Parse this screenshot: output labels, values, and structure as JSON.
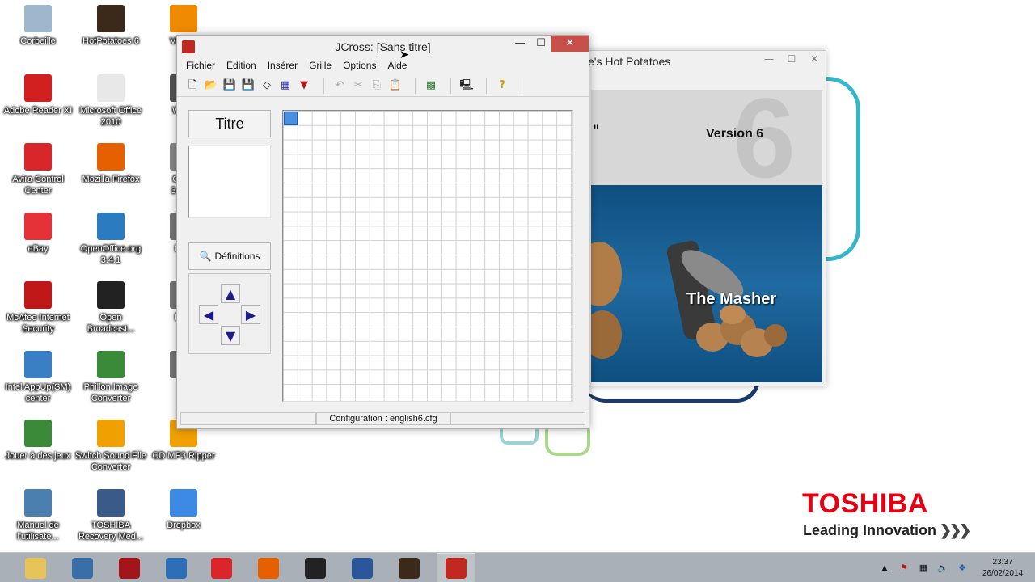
{
  "desktop": {
    "icons": [
      {
        "label": "Corbeille",
        "icon": "recycle-bin-icon",
        "color": "#9fb7cc"
      },
      {
        "label": "HotPotatoes 6",
        "icon": "hotpotatoes-icon",
        "color": "#3b2a1a"
      },
      {
        "label": "VLC m",
        "icon": "vlc-icon",
        "color": "#f08a00"
      },
      {
        "label": "Adobe Reader XI",
        "icon": "adobe-reader-icon",
        "color": "#d21f1f"
      },
      {
        "label": "Microsoft Office\n2010",
        "icon": "document-icon",
        "color": "#e8e8e8"
      },
      {
        "label": "Wave\n6",
        "icon": "wave-icon",
        "color": "#555555"
      },
      {
        "label": "Avira Control\nCenter",
        "icon": "avira-icon",
        "color": "#d8262a"
      },
      {
        "label": "Mozilla Firefox",
        "icon": "firefox-icon",
        "color": "#e66000"
      },
      {
        "label": "Open\n3.4.1 (",
        "icon": "openoffice-icon",
        "color": "#888888"
      },
      {
        "label": "eBay",
        "icon": "ebay-icon",
        "color": "#e53238"
      },
      {
        "label": "OpenOffice.org\n3.4.1",
        "icon": "openoffice-icon",
        "color": "#2a7bbf"
      },
      {
        "label": "MyS",
        "icon": "app-icon",
        "color": "#777777"
      },
      {
        "label": "McAfee Internet\nSecurity",
        "icon": "mcafee-icon",
        "color": "#c01818"
      },
      {
        "label": "Open\nBroadcast...",
        "icon": "obs-icon",
        "color": "#222222"
      },
      {
        "label": "FRE",
        "icon": "app-icon",
        "color": "#777777"
      },
      {
        "label": "Intel AppUp(SM)\ncenter",
        "icon": "intel-icon",
        "color": "#3a7fc4"
      },
      {
        "label": "Phillon Image\nConverter",
        "icon": "image-converter-icon",
        "color": "#3a8a3a"
      },
      {
        "label": "ca",
        "icon": "app-icon",
        "color": "#777777"
      },
      {
        "label": "Jouer à des jeux",
        "icon": "games-icon",
        "color": "#3a8a3a"
      },
      {
        "label": "Switch Sound File\nConverter",
        "icon": "switch-icon",
        "color": "#f0a000"
      },
      {
        "label": "CD MP3 Ripper",
        "icon": "cd-ripper-icon",
        "color": "#f0a000"
      },
      {
        "label": "Manuel de\nl'utilisate...",
        "icon": "manual-icon",
        "color": "#4a7fb0"
      },
      {
        "label": "TOSHIBA\nRecovery Med...",
        "icon": "recovery-icon",
        "color": "#3a5a8a"
      },
      {
        "label": "Dropbox",
        "icon": "dropbox-icon",
        "color": "#3d8ae5"
      }
    ]
  },
  "hotpotatoes": {
    "title": "e's Hot Potatoes",
    "big_number": "6",
    "version": "Version 6",
    "product": "The Masher",
    "quote": "\""
  },
  "jcross": {
    "title": "JCross: [Sans titre]",
    "menu": [
      "Fichier",
      "Edition",
      "Insérer",
      "Grille",
      "Options",
      "Aide"
    ],
    "toolbar": {
      "new": "🗋",
      "open": "📂",
      "save": "💾",
      "save_as": "💾",
      "clear": "◇",
      "grid": "▦",
      "export": "▼",
      "undo": "↶",
      "cut": "✂",
      "copy": "⎘",
      "paste": "📋",
      "fill": "▩",
      "web": "🖳",
      "help": "?"
    },
    "titre_button": "Titre",
    "definitions_button": "Définitions",
    "definitions_icon": "🔍",
    "arrows": {
      "up": "▲",
      "left": "◀",
      "right": "▶",
      "down": "▼"
    },
    "status": "Configuration : english6.cfg",
    "controls": {
      "minimize": "—",
      "maximize": "☐",
      "close": "✕"
    }
  },
  "branding": {
    "brand": "TOSHIBA",
    "tagline": "Leading Innovation",
    "chevrons": "❯❯❯",
    "brand_color": "#e60012"
  },
  "taskbar": {
    "items": [
      {
        "name": "file-explorer-icon",
        "color": "#e8c35a"
      },
      {
        "name": "network-icon",
        "color": "#3a6ea8"
      },
      {
        "name": "media-icon",
        "color": "#a3151b"
      },
      {
        "name": "chat-icon",
        "color": "#2d6eb5"
      },
      {
        "name": "nero-icon",
        "color": "#d8262a"
      },
      {
        "name": "firefox-icon",
        "color": "#e66000"
      },
      {
        "name": "obs-icon",
        "color": "#222222"
      },
      {
        "name": "word-icon",
        "color": "#2b579a"
      },
      {
        "name": "hotpotatoes-icon",
        "color": "#3b2a1a"
      },
      {
        "name": "jcross-icon",
        "color": "#c0291f"
      }
    ],
    "tray": {
      "up": "▲",
      "flag": "⚑",
      "network": "▦",
      "volume": "🔈",
      "dropbox": "❖"
    },
    "time": "23:37",
    "date": "26/02/2014"
  }
}
